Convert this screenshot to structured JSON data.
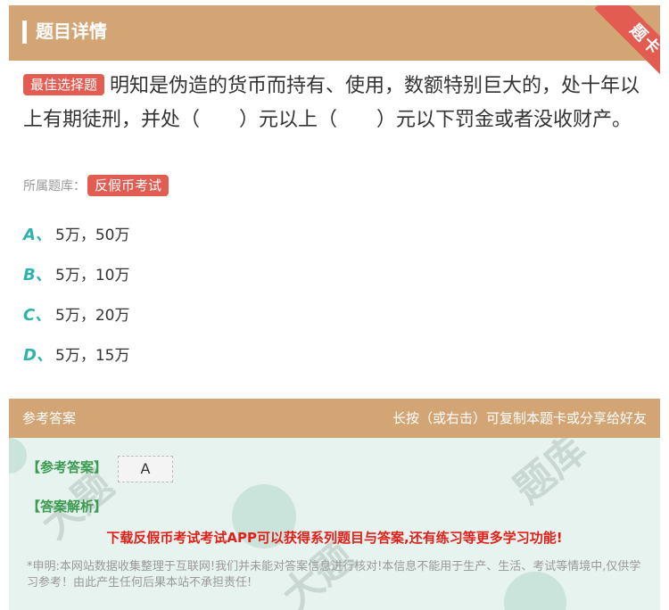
{
  "header": {
    "title": "题目详情",
    "ribbon": "题卡"
  },
  "question": {
    "tag": "最佳选择题",
    "text": "明知是伪造的货币而持有、使用，数额特别巨大的，处十年以上有期徒刑，并处（　　）元以上（　　）元以下罚金或者没收财产。"
  },
  "source": {
    "label": "所属题库：",
    "tag": "反假币考试"
  },
  "options": [
    {
      "letter": "A、",
      "text": "5万，50万"
    },
    {
      "letter": "B、",
      "text": "5万，10万"
    },
    {
      "letter": "C、",
      "text": "5万，20万"
    },
    {
      "letter": "D、",
      "text": "5万，15万"
    }
  ],
  "answer_header": {
    "left": "参考答案",
    "right": "长按（或右击）可复制本题卡或分享给好友"
  },
  "answer": {
    "ref_label": "【参考答案】",
    "ref_value": "A",
    "exp_label": "【答案解析】",
    "promo": "下载反假币考试考试APP可以获得系列题目与答案,还有练习等更多学习功能!",
    "disclaimer": "*申明:本网站数据收集整理于互联网!我们并未能对答案信息进行核对!本信息不能用于生产、生活、考试等情境中,仅供学习参考！由此产生任何后果本站不承担责任!"
  },
  "colors": {
    "accent": "#d3a575",
    "tag": "#e25c52",
    "option_letter": "#2fb4ad",
    "answer_label": "#3a9b51",
    "promo": "#e0201a"
  }
}
